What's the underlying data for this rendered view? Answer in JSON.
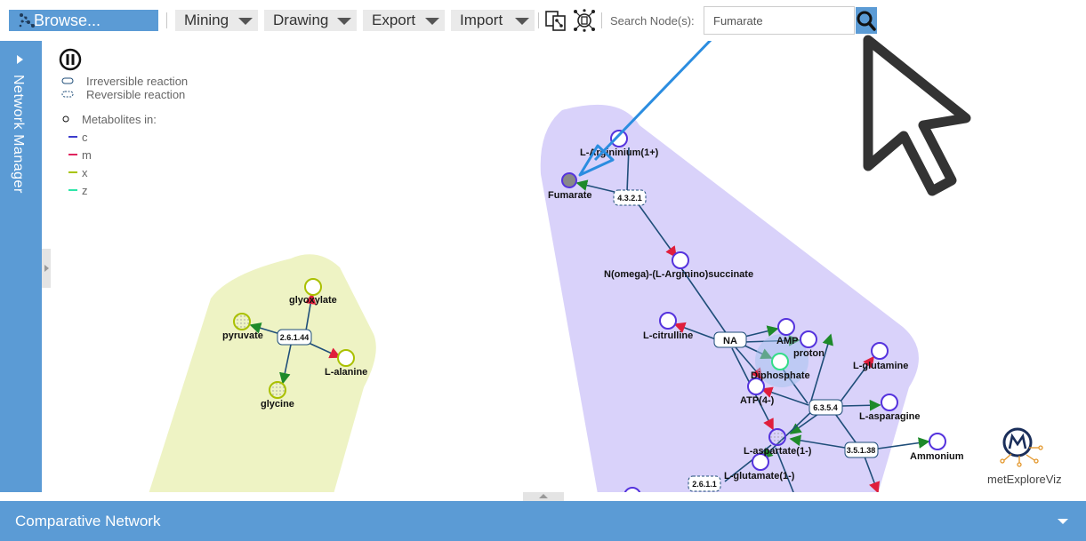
{
  "toolbar": {
    "browse_label": "Browse...",
    "menus": [
      "Mining",
      "Drawing",
      "Export",
      "Import"
    ],
    "search_label": "Search Node(s):",
    "search_value": "Fumarate"
  },
  "side_panel": {
    "label": "Network Manager"
  },
  "legend": {
    "irreversible": "Irreversible reaction",
    "reversible": "Reversible reaction",
    "metabolites_in": "Metabolites in:",
    "compartments": [
      {
        "name": "c",
        "color": "#3d3dcc"
      },
      {
        "name": "m",
        "color": "#e0245e"
      },
      {
        "name": "x",
        "color": "#a8c400"
      },
      {
        "name": "z",
        "color": "#2ee6a8"
      }
    ]
  },
  "graph": {
    "metabolites": [
      "L-Argininium(1+)",
      "Fumarate",
      "N(omega)-(L-Arginino)succinate",
      "L-citrulline",
      "AMP",
      "proton",
      "Diphosphate",
      "ATP(4-)",
      "L-glutamine",
      "L-asparagine",
      "Ammonium",
      "L-aspartate(1-)",
      "L-glutamate(1-)",
      "glyoxylate",
      "pyruvate",
      "L-alanine",
      "glycine"
    ],
    "reactions": [
      "4.3.2.1",
      "NA",
      "6.3.5.4",
      "3.5.1.38",
      "2.6.1.1",
      "2.6.1.44"
    ]
  },
  "logo_text": "metExploreViz",
  "bottom_bar": {
    "title": "Comparative Network"
  },
  "colors": {
    "accent": "#5b9bd5",
    "cluster_purple": "#d9d2fa",
    "cluster_green": "#eef3c4",
    "node_c": "#5533dd",
    "node_x": "#aac000",
    "node_z": "#33dd88",
    "edge": "#1f4e79",
    "highlight_arrow": "#2b8de0"
  }
}
